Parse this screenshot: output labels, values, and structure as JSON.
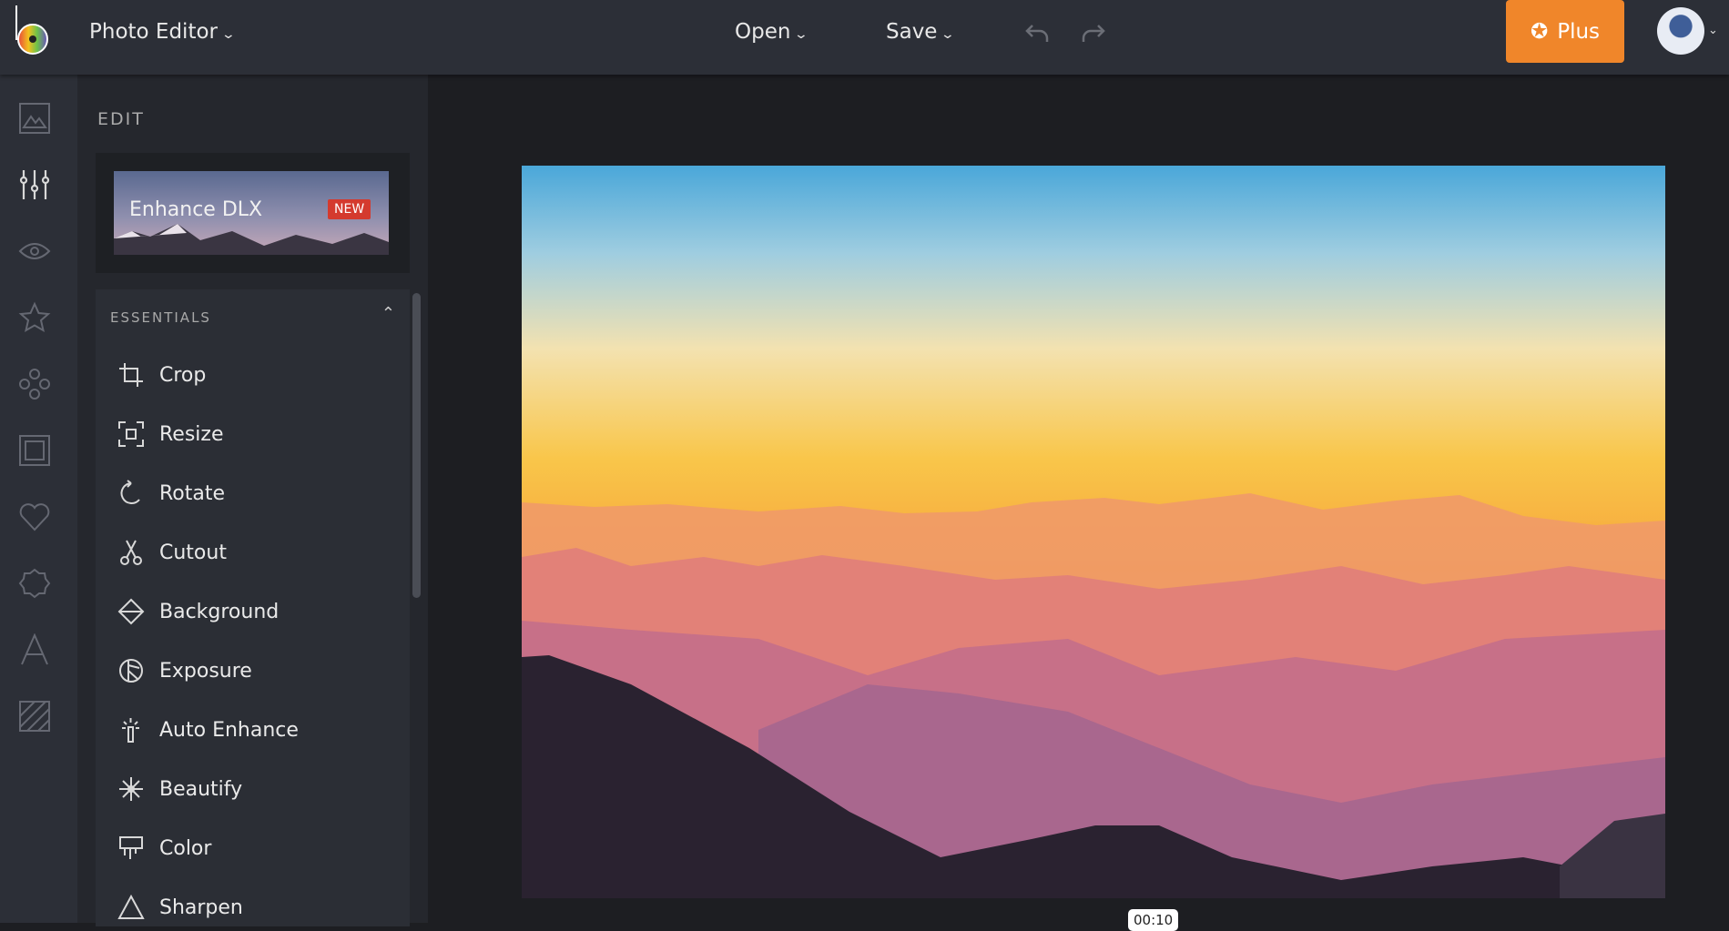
{
  "header": {
    "app_title": "Photo Editor",
    "open_label": "Open",
    "save_label": "Save",
    "plus_label": "Plus"
  },
  "panel": {
    "section_title": "EDIT",
    "promo": {
      "label": "Enhance DLX",
      "badge": "NEW"
    },
    "essentials": {
      "title": "ESSENTIALS",
      "tools": [
        {
          "label": "Crop",
          "icon": "crop-icon"
        },
        {
          "label": "Resize",
          "icon": "resize-icon"
        },
        {
          "label": "Rotate",
          "icon": "rotate-icon"
        },
        {
          "label": "Cutout",
          "icon": "scissors-icon"
        },
        {
          "label": "Background",
          "icon": "background-icon"
        },
        {
          "label": "Exposure",
          "icon": "exposure-icon"
        },
        {
          "label": "Auto Enhance",
          "icon": "magic-wand-icon"
        },
        {
          "label": "Beautify",
          "icon": "beautify-icon"
        },
        {
          "label": "Color",
          "icon": "color-icon"
        },
        {
          "label": "Sharpen",
          "icon": "sharpen-icon"
        }
      ]
    }
  },
  "rail": [
    "image-icon",
    "sliders-icon",
    "eye-icon",
    "star-icon",
    "shapes-icon",
    "frame-icon",
    "heart-icon",
    "badge-icon",
    "text-icon",
    "texture-icon"
  ],
  "timer": "00:10",
  "colors": {
    "accent": "#f0862a",
    "badge": "#d43a2e"
  }
}
